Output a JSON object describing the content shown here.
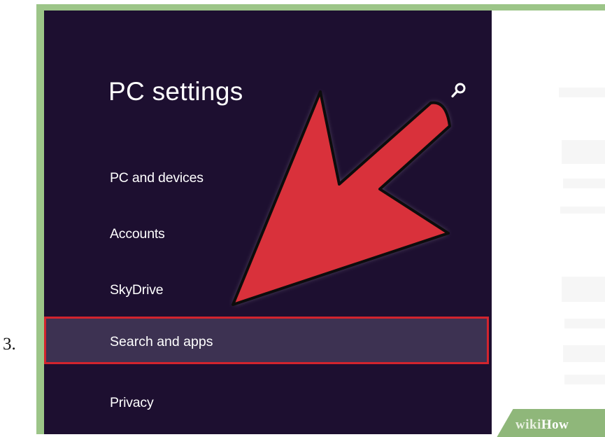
{
  "step": {
    "number": "3."
  },
  "window": {
    "title": "PC settings"
  },
  "sidebar": {
    "items": [
      {
        "label": "PC and devices"
      },
      {
        "label": "Accounts"
      },
      {
        "label": "SkyDrive"
      },
      {
        "label": "Search and apps",
        "selected": true
      },
      {
        "label": "Privacy"
      }
    ]
  },
  "icons": {
    "search": "search-icon",
    "arrow": "red-pointer-arrow"
  },
  "watermark": {
    "brand_a": "wiki",
    "brand_b": "How"
  },
  "colors": {
    "sidebar_bg": "#1d0f30",
    "selected_bg": "#3d3252",
    "highlight_border": "#d2242e",
    "arrow_fill": "#d9313b",
    "frame": "#9cc588"
  }
}
